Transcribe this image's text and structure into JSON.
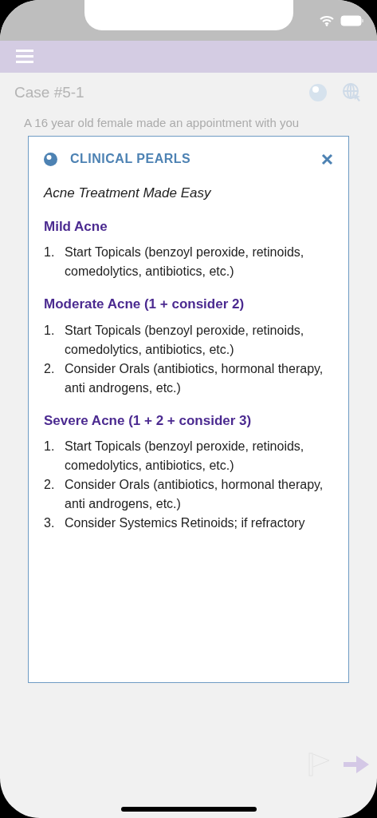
{
  "case": {
    "title": "Case #5-1",
    "text": "A 16 year old female made an appointment with you"
  },
  "modal": {
    "title": "CLINICAL PEARLS",
    "subtitle": "Acne Treatment Made Easy",
    "sections": [
      {
        "heading": "Mild Acne",
        "items": [
          {
            "number": "1.",
            "text": "Start Topicals (benzoyl peroxide, retinoids, comedolytics, antibiotics, etc.)"
          }
        ]
      },
      {
        "heading": "Moderate Acne (1 + consider 2)",
        "items": [
          {
            "number": "1.",
            "text": "Start Topicals (benzoyl peroxide, retinoids, comedolytics, antibiotics, etc.)"
          },
          {
            "number": "2.",
            "text": "Consider Orals (antibiotics, hormonal therapy, anti androgens, etc.)"
          }
        ]
      },
      {
        "heading": "Severe Acne (1 + 2 + consider 3)",
        "items": [
          {
            "number": "1.",
            "text": "Start Topicals (benzoyl peroxide, retinoids, comedolytics, antibiotics, etc.)"
          },
          {
            "number": "2.",
            "text": "Consider Orals (antibiotics, hormonal therapy, anti androgens, etc.)"
          },
          {
            "number": "3.",
            "text": "Consider Systemics Retinoids; if refractory"
          }
        ]
      }
    ]
  }
}
